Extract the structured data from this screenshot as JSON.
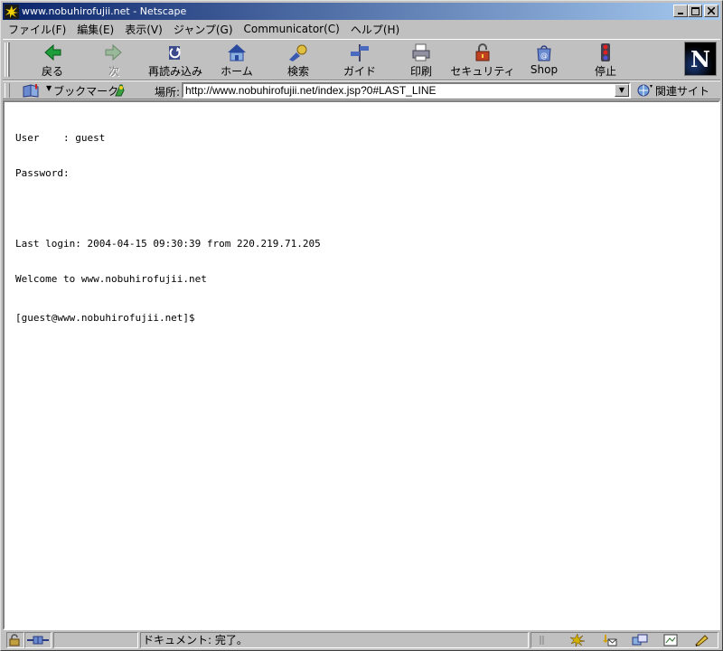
{
  "window": {
    "title": "www.nobuhirofujii.net - Netscape"
  },
  "menu": [
    {
      "label": "ファイル(F)"
    },
    {
      "label": "編集(E)"
    },
    {
      "label": "表示(V)"
    },
    {
      "label": "ジャンプ(G)"
    },
    {
      "label": "Communicator(C)"
    },
    {
      "label": "ヘルプ(H)"
    }
  ],
  "toolbar": {
    "buttons": [
      {
        "label": "戻る",
        "icon": "back-arrow-icon",
        "enabled": true
      },
      {
        "label": "次",
        "icon": "forward-arrow-icon",
        "enabled": false
      },
      {
        "label": "再読み込み",
        "icon": "reload-icon",
        "enabled": true
      },
      {
        "label": "ホーム",
        "icon": "home-icon",
        "enabled": true
      },
      {
        "label": "検索",
        "icon": "search-icon",
        "enabled": true
      },
      {
        "label": "ガイド",
        "icon": "guide-icon",
        "enabled": true
      },
      {
        "label": "印刷",
        "icon": "print-icon",
        "enabled": true
      },
      {
        "label": "セキュリティ",
        "icon": "security-lock-icon",
        "enabled": true
      },
      {
        "label": "Shop",
        "icon": "shop-icon",
        "enabled": true
      },
      {
        "label": "停止",
        "icon": "stop-icon",
        "enabled": true
      }
    ],
    "logo": "N"
  },
  "location": {
    "bookmarks_label": "ブックマーク",
    "location_label": "場所:",
    "url": "http://www.nobuhirofujii.net/index.jsp?0#LAST_LINE",
    "related_label": "関連サイト"
  },
  "terminal": {
    "user_line": "User    : guest",
    "password_line": "Password:",
    "last_login_line": "Last login: 2004-04-15 09:30:39 from 220.219.71.205",
    "welcome_line": "Welcome to www.nobuhirofujii.net",
    "prompt_line": "[guest@www.nobuhirofujii.net]$"
  },
  "status": {
    "text": "ドキュメント: 完了。"
  },
  "colors": {
    "titlebar_start": "#0a246a",
    "titlebar_end": "#a6caf0",
    "chrome": "#c0c0c0"
  }
}
